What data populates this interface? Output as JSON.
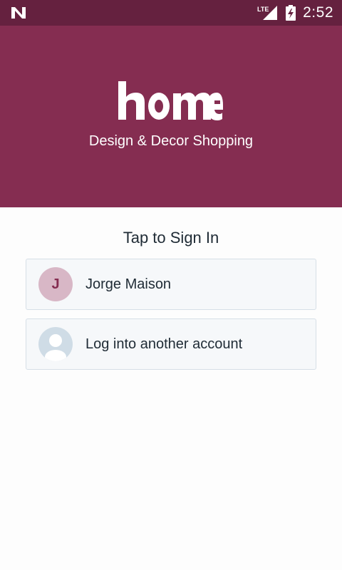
{
  "status_bar": {
    "time": "2:52",
    "network_label": "LTE",
    "icons": [
      "notification-n-icon",
      "lte-signal-icon",
      "battery-charging-icon"
    ]
  },
  "header": {
    "logo_text": "home",
    "tagline": "Design & Decor Shopping",
    "colors": {
      "background": "#852d51",
      "status_bar": "#65213f"
    }
  },
  "sign_in": {
    "title": "Tap to Sign In",
    "accounts": [
      {
        "initial": "J",
        "name": "Jorge Maison",
        "avatar_color": "#d8b7c6"
      },
      {
        "name": "Log into another account",
        "icon": "person-icon"
      }
    ]
  }
}
